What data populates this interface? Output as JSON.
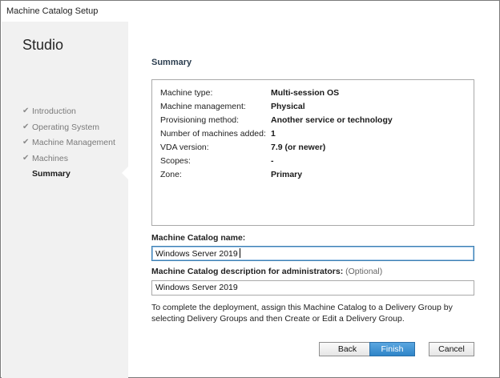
{
  "window": {
    "title": "Machine Catalog Setup"
  },
  "sidebar": {
    "heading": "Studio",
    "items": [
      {
        "label": "Introduction",
        "done": true
      },
      {
        "label": "Operating System",
        "done": true
      },
      {
        "label": "Machine Management",
        "done": true
      },
      {
        "label": "Machines",
        "done": true
      },
      {
        "label": "Summary",
        "done": false,
        "current": true
      }
    ],
    "check_glyph": "✔"
  },
  "main": {
    "section_title": "Summary",
    "summary": [
      {
        "key": "Machine type:",
        "value": "Multi-session OS"
      },
      {
        "key": "Machine management:",
        "value": "Physical"
      },
      {
        "key": "Provisioning method:",
        "value": "Another service or technology"
      },
      {
        "key": "Number of machines added:",
        "value": "1"
      },
      {
        "key": "VDA version:",
        "value": "7.9 (or newer)"
      },
      {
        "key": "Scopes:",
        "value": "-"
      },
      {
        "key": "Zone:",
        "value": "Primary"
      }
    ],
    "name_label": "Machine Catalog name:",
    "name_value": "Windows Server 2019",
    "desc_label": "Machine Catalog description for administrators:",
    "desc_optional": "(Optional)",
    "desc_value": "Windows Server 2019",
    "info_text": "To complete the deployment, assign this Machine Catalog to a Delivery Group by selecting Delivery Groups and then Create or Edit a Delivery Group."
  },
  "buttons": {
    "back": "Back",
    "finish": "Finish",
    "cancel": "Cancel"
  },
  "colors": {
    "accent": "#2f85c8",
    "sidebar_bg": "#f1f1f1"
  }
}
